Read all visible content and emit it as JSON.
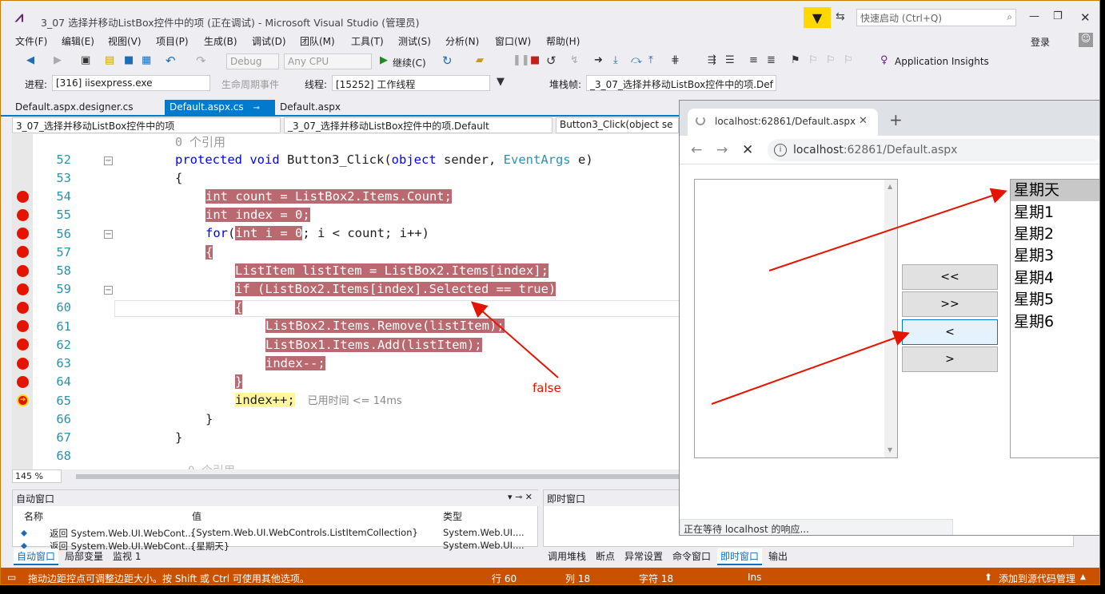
{
  "window": {
    "title": "3_07 选择并移动ListBox控件中的项 (正在调试) - Microsoft Visual Studio (管理员)",
    "quick_launch_placeholder": "快速启动 (Ctrl+Q)",
    "login": "登录"
  },
  "menu": [
    "文件(F)",
    "编辑(E)",
    "视图(V)",
    "项目(P)",
    "生成(B)",
    "调试(D)",
    "团队(M)",
    "工具(T)",
    "测试(S)",
    "分析(N)",
    "窗口(W)",
    "帮助(H)"
  ],
  "toolbar": {
    "config": "Debug",
    "platform": "Any CPU",
    "continue_label": "继续(C)",
    "app_insights": "Application Insights"
  },
  "debug_toolbar": {
    "process_label": "进程:",
    "process_value": "[316] iisexpress.exe",
    "lifecycle_label": "生命周期事件",
    "thread_label": "线程:",
    "thread_value": "[15252] 工作线程",
    "stack_label": "堆栈帧:",
    "stack_value": "_3_07_选择并移动ListBox控件中的项.Def"
  },
  "tabs": [
    "Default.aspx.designer.cs",
    "Default.aspx.cs",
    "Default.aspx"
  ],
  "nav": {
    "project": "3_07_选择并移动ListBox控件中的项",
    "class": "_3_07_选择并移动ListBox控件中的项.Default",
    "member": "Button3_Click(object se"
  },
  "editor": {
    "ref_top": "0 个引用",
    "ref_bottom": "0 个引用",
    "lines": {
      "l52": "52",
      "l53": "53",
      "l54": "54",
      "l55": "55",
      "l56": "56",
      "l57": "57",
      "l58": "58",
      "l59": "59",
      "l60": "60",
      "l61": "61",
      "l62": "62",
      "l63": "63",
      "l64": "64",
      "l65": "65",
      "l66": "66",
      "l67": "67",
      "l68": "68"
    },
    "code": {
      "protected": "protected",
      "void": "void",
      "method": " Button3_Click(",
      "object": "object",
      "sender": " sender, ",
      "eventargs": "EventArgs",
      "e": " e)",
      "brace_open": "{",
      "c54": "int count = ListBox2.Items.Count;",
      "c55": "int index = 0;",
      "c56_for": "for",
      "c56_paren": "(",
      "c56_init": "int i = 0",
      "c56_rest": "; i < count; i++)",
      "c57": "{",
      "c58": "ListItem listItem = ListBox2.Items[index];",
      "c59": "if (ListBox2.Items[index].Selected == true)",
      "c60": "{",
      "c61": "ListBox2.Items.Remove(listItem);",
      "c62": "ListBox1.Items.Add(listItem);",
      "c63": "index--;",
      "c64": "}",
      "c65": "index++;",
      "elapsed": "已用时间 <= 14ms",
      "c66": "}",
      "c67": "}"
    },
    "zoom": "145 %"
  },
  "autos": {
    "title": "自动窗口",
    "col_name": "名称",
    "col_value": "值",
    "col_type": "类型",
    "row1_name": "返回 System.Web.UI.WebCont...",
    "row1_value": "{System.Web.UI.WebControls.ListItemCollection}",
    "row1_type": "System.Web.UI....",
    "row2_name": "返回 System.Web.UI.WebCont...",
    "row2_value": "{星期天}",
    "row2_type": "System.Web.UI...."
  },
  "immediate": {
    "title": "即时窗口"
  },
  "bottom_tabs_left": [
    "自动窗口",
    "局部变量",
    "监视 1"
  ],
  "bottom_tabs_right": [
    "调用堆栈",
    "断点",
    "异常设置",
    "命令窗口",
    "即时窗口",
    "输出"
  ],
  "statusbar": {
    "message": "拖动边距控点可调整边距大小。按 Shift 或 Ctrl 可使用其他选项。",
    "line": "行 60",
    "col": "列 18",
    "char": "字符 18",
    "ins": "Ins",
    "source_control": "添加到源代码管理"
  },
  "browser": {
    "tab_title": "localhost:62861/Default.aspx",
    "url_host": "localhost",
    "url_rest": ":62861/Default.aspx",
    "status": "正在等待 localhost 的响应...",
    "buttons": [
      "<<",
      ">>",
      "<",
      ">"
    ],
    "listbox2": [
      "星期天",
      "星期1",
      "星期2",
      "星期3",
      "星期4",
      "星期5",
      "星期6"
    ],
    "selected_index": 0
  },
  "annotation": {
    "false_label": "false"
  },
  "colors": {
    "accent": "#007acc",
    "status": "#ca5100",
    "breakpoint": "#e51400",
    "highlight": "#b9696f"
  }
}
